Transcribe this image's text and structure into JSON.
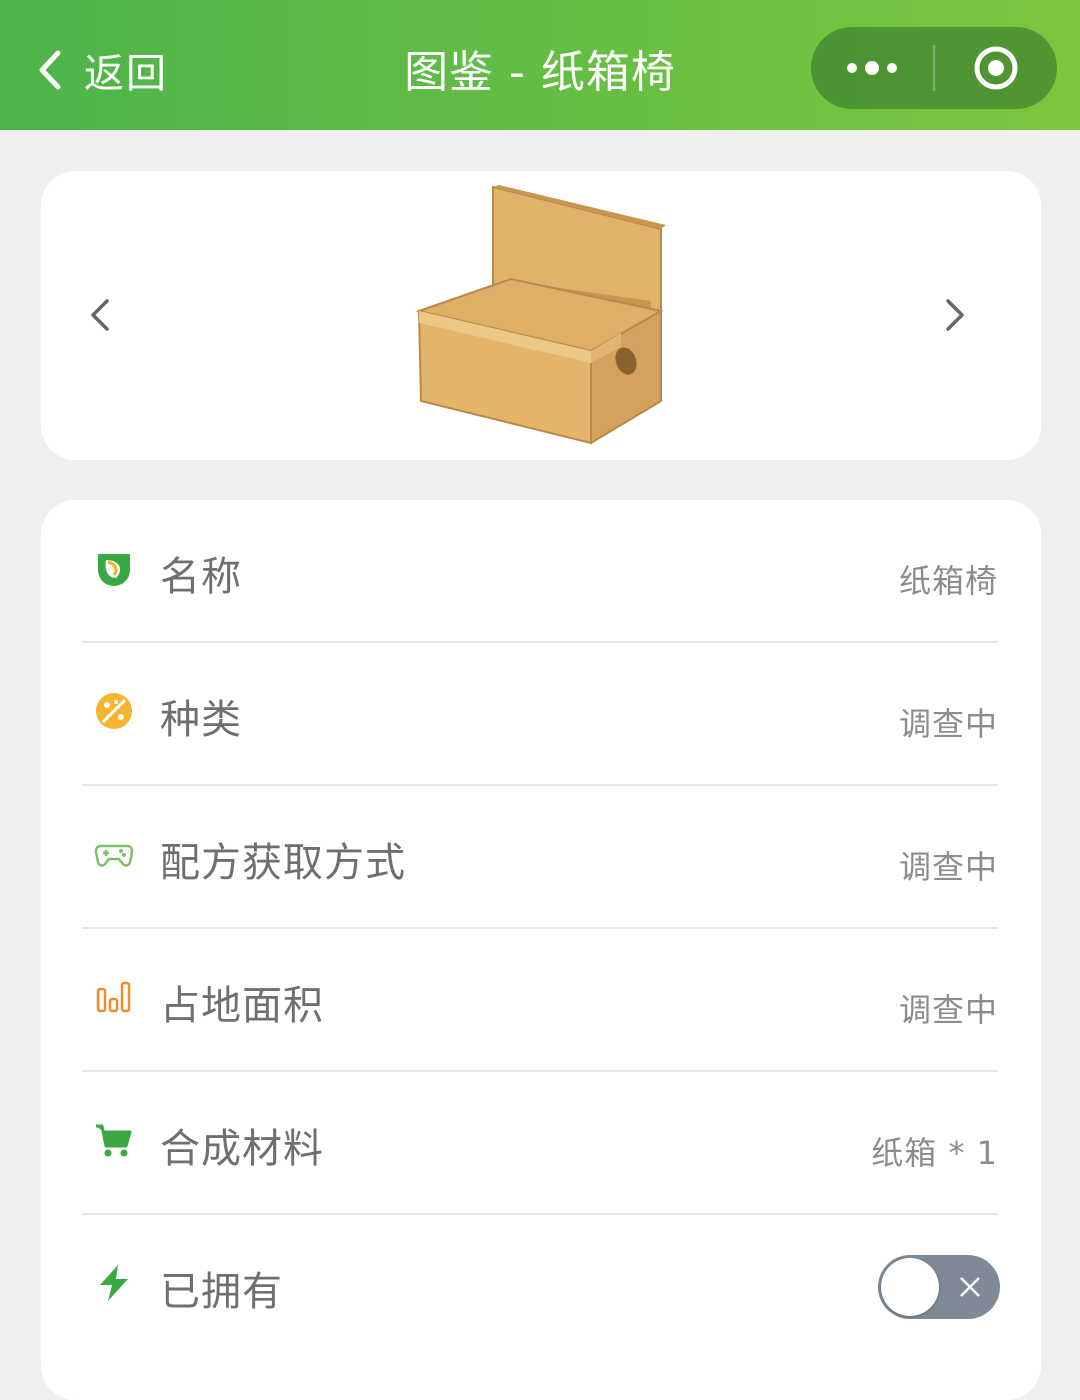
{
  "header": {
    "back_label": "返回",
    "title": "图鉴 - 纸箱椅",
    "capsule_icons": [
      "more-dots-icon",
      "target-circle-icon"
    ]
  },
  "gallery": {
    "prev_icon": "chevron-left-icon",
    "next_icon": "chevron-right-icon",
    "image_icon": "cardboard-box-image"
  },
  "details": {
    "rows": [
      {
        "icon": "leaf-icon",
        "label": "名称",
        "value": "纸箱椅",
        "icon_color": "#3aa843"
      },
      {
        "icon": "palette-icon",
        "label": "种类",
        "value": "调查中",
        "icon_color": "#f5b52e"
      },
      {
        "icon": "gamepad-icon",
        "label": "配方获取方式",
        "value": "调查中",
        "icon_color": "#7cc06a"
      },
      {
        "icon": "bar-chart-icon",
        "label": "占地面积",
        "value": "调查中",
        "icon_color": "#ef8a2e"
      },
      {
        "icon": "cart-icon",
        "label": "合成材料",
        "value": "纸箱 * 1",
        "icon_color": "#3aa843"
      },
      {
        "icon": "bolt-icon",
        "label": "已拥有",
        "value": "",
        "icon_color": "#3aa843"
      }
    ],
    "owned_toggle": {
      "on": false
    }
  },
  "colors": {
    "header_start": "#4cb449",
    "header_end": "#7dc63e",
    "toggle_off": "#7e8b96"
  }
}
